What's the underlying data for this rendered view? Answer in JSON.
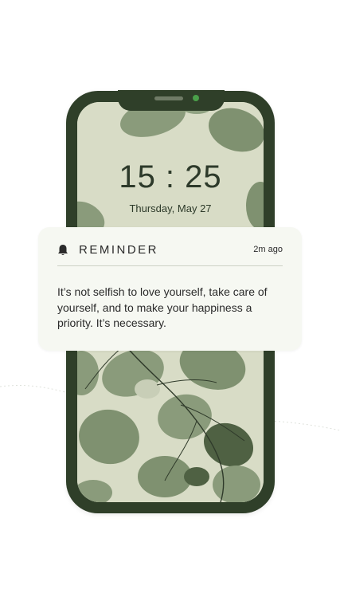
{
  "lockscreen": {
    "time": "15 : 25",
    "date": "Thursday, May 27"
  },
  "notification": {
    "icon": "bell-icon",
    "title": "REMINDER",
    "time_ago": "2m ago",
    "message": "It’s not selfish to love yourself, take care of yourself, and to make your happiness a priority. It’s necessary."
  },
  "colors": {
    "phone_frame": "#2f3f29",
    "wallpaper_bg": "#d8dcc6",
    "leaf": "#7f9170",
    "leaf_dark": "#4f6143",
    "card_bg": "#f6f8f2",
    "text": "#2b2b2b"
  }
}
